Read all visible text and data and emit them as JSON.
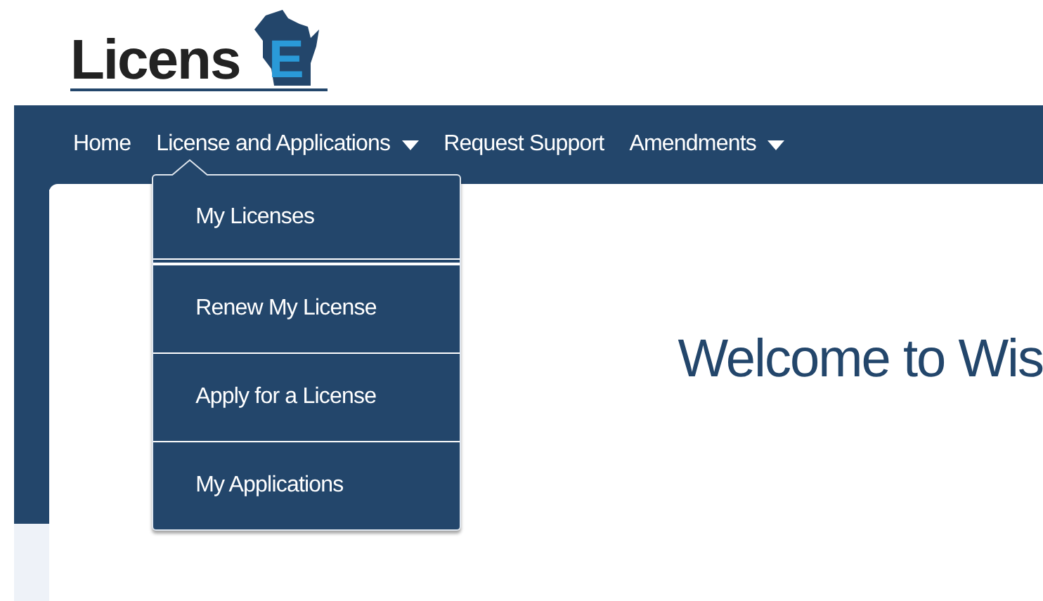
{
  "logo": {
    "text": "Licens",
    "letter": "E"
  },
  "nav": [
    {
      "label": "Home",
      "has_menu": false
    },
    {
      "label": "License and Applications",
      "has_menu": true,
      "menu": [
        "My Licenses",
        "Renew My License",
        "Apply for a License",
        "My Applications"
      ]
    },
    {
      "label": "Request Support",
      "has_menu": false
    },
    {
      "label": "Amendments",
      "has_menu": true
    }
  ],
  "heading": "Welcome to Wis"
}
